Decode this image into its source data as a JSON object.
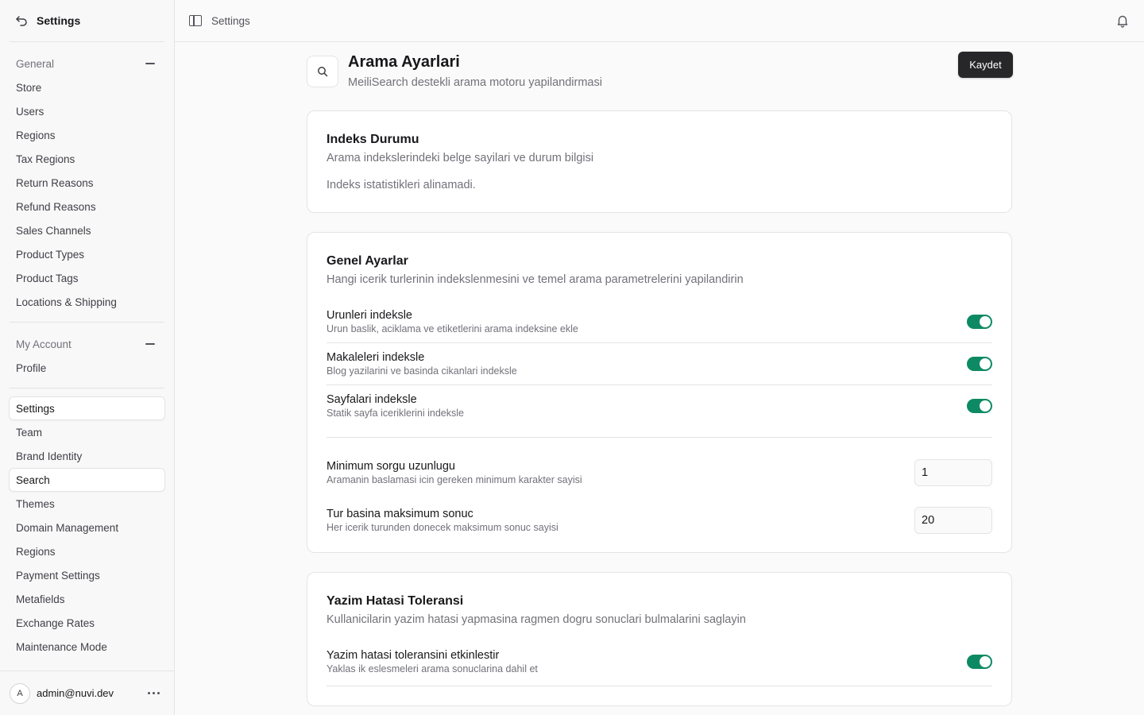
{
  "sidebar": {
    "title": "Settings",
    "general_label": "General",
    "general_items": [
      "Store",
      "Users",
      "Regions",
      "Tax Regions",
      "Return Reasons",
      "Refund Reasons",
      "Sales Channels",
      "Product Types",
      "Product Tags",
      "Locations & Shipping"
    ],
    "account_label": "My Account",
    "account_items": [
      "Profile"
    ],
    "extra_items": [
      "Settings",
      "Team",
      "Brand Identity",
      "Search",
      "Themes",
      "Domain Management",
      "Regions",
      "Payment Settings",
      "Metafields",
      "Exchange Rates",
      "Maintenance Mode"
    ],
    "user": {
      "initial": "A",
      "email": "admin@nuvi.dev"
    }
  },
  "topbar": {
    "breadcrumb": "Settings"
  },
  "page": {
    "title": "Arama Ayarlari",
    "subtitle": "MeiliSearch destekli arama motoru yapilandirmasi",
    "save_label": "Kaydet"
  },
  "index_card": {
    "title": "Indeks Durumu",
    "subtitle": "Arama indekslerindeki belge sayilari ve durum bilgisi",
    "note": "Indeks istatistikleri alinamadi."
  },
  "general_card": {
    "title": "Genel Ayarlar",
    "subtitle": "Hangi icerik turlerinin indekslenmesini ve temel arama parametrelerini yapilandirin",
    "toggles": [
      {
        "label": "Urunleri indeksle",
        "desc": "Urun baslik, aciklama ve etiketlerini arama indeksine ekle",
        "on": true
      },
      {
        "label": "Makaleleri indeksle",
        "desc": "Blog yazilarini ve basinda cikanlari indeksle",
        "on": true
      },
      {
        "label": "Sayfalari indeksle",
        "desc": "Statik sayfa iceriklerini indeksle",
        "on": true
      }
    ],
    "min_query": {
      "label": "Minimum sorgu uzunlugu",
      "desc": "Aramanin baslamasi icin gereken minimum karakter sayisi",
      "value": "1"
    },
    "max_results": {
      "label": "Tur basina maksimum sonuc",
      "desc": "Her icerik turunden donecek maksimum sonuc sayisi",
      "value": "20"
    }
  },
  "typo_card": {
    "title": "Yazim Hatasi Toleransi",
    "subtitle": "Kullanicilarin yazim hatasi yapmasina ragmen dogru sonuclari bulmalarini saglayin",
    "toggle": {
      "label": "Yazim hatasi toleransini etkinlestir",
      "desc": "Yaklas ik eslesmeleri arama sonuclarina dahil et",
      "on": true
    }
  },
  "colors": {
    "accent": "#0d8a63",
    "button": "#27272a"
  }
}
